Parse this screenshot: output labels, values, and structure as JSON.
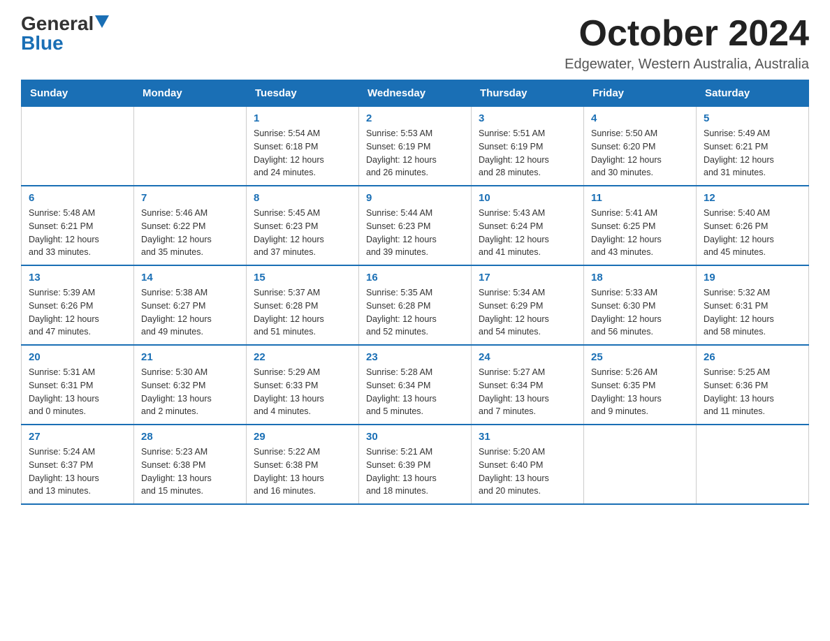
{
  "header": {
    "logo_general": "General",
    "logo_blue": "Blue",
    "month_title": "October 2024",
    "location": "Edgewater, Western Australia, Australia"
  },
  "weekdays": [
    "Sunday",
    "Monday",
    "Tuesday",
    "Wednesday",
    "Thursday",
    "Friday",
    "Saturday"
  ],
  "weeks": [
    [
      {
        "day": "",
        "info": ""
      },
      {
        "day": "",
        "info": ""
      },
      {
        "day": "1",
        "info": "Sunrise: 5:54 AM\nSunset: 6:18 PM\nDaylight: 12 hours\nand 24 minutes."
      },
      {
        "day": "2",
        "info": "Sunrise: 5:53 AM\nSunset: 6:19 PM\nDaylight: 12 hours\nand 26 minutes."
      },
      {
        "day": "3",
        "info": "Sunrise: 5:51 AM\nSunset: 6:19 PM\nDaylight: 12 hours\nand 28 minutes."
      },
      {
        "day": "4",
        "info": "Sunrise: 5:50 AM\nSunset: 6:20 PM\nDaylight: 12 hours\nand 30 minutes."
      },
      {
        "day": "5",
        "info": "Sunrise: 5:49 AM\nSunset: 6:21 PM\nDaylight: 12 hours\nand 31 minutes."
      }
    ],
    [
      {
        "day": "6",
        "info": "Sunrise: 5:48 AM\nSunset: 6:21 PM\nDaylight: 12 hours\nand 33 minutes."
      },
      {
        "day": "7",
        "info": "Sunrise: 5:46 AM\nSunset: 6:22 PM\nDaylight: 12 hours\nand 35 minutes."
      },
      {
        "day": "8",
        "info": "Sunrise: 5:45 AM\nSunset: 6:23 PM\nDaylight: 12 hours\nand 37 minutes."
      },
      {
        "day": "9",
        "info": "Sunrise: 5:44 AM\nSunset: 6:23 PM\nDaylight: 12 hours\nand 39 minutes."
      },
      {
        "day": "10",
        "info": "Sunrise: 5:43 AM\nSunset: 6:24 PM\nDaylight: 12 hours\nand 41 minutes."
      },
      {
        "day": "11",
        "info": "Sunrise: 5:41 AM\nSunset: 6:25 PM\nDaylight: 12 hours\nand 43 minutes."
      },
      {
        "day": "12",
        "info": "Sunrise: 5:40 AM\nSunset: 6:26 PM\nDaylight: 12 hours\nand 45 minutes."
      }
    ],
    [
      {
        "day": "13",
        "info": "Sunrise: 5:39 AM\nSunset: 6:26 PM\nDaylight: 12 hours\nand 47 minutes."
      },
      {
        "day": "14",
        "info": "Sunrise: 5:38 AM\nSunset: 6:27 PM\nDaylight: 12 hours\nand 49 minutes."
      },
      {
        "day": "15",
        "info": "Sunrise: 5:37 AM\nSunset: 6:28 PM\nDaylight: 12 hours\nand 51 minutes."
      },
      {
        "day": "16",
        "info": "Sunrise: 5:35 AM\nSunset: 6:28 PM\nDaylight: 12 hours\nand 52 minutes."
      },
      {
        "day": "17",
        "info": "Sunrise: 5:34 AM\nSunset: 6:29 PM\nDaylight: 12 hours\nand 54 minutes."
      },
      {
        "day": "18",
        "info": "Sunrise: 5:33 AM\nSunset: 6:30 PM\nDaylight: 12 hours\nand 56 minutes."
      },
      {
        "day": "19",
        "info": "Sunrise: 5:32 AM\nSunset: 6:31 PM\nDaylight: 12 hours\nand 58 minutes."
      }
    ],
    [
      {
        "day": "20",
        "info": "Sunrise: 5:31 AM\nSunset: 6:31 PM\nDaylight: 13 hours\nand 0 minutes."
      },
      {
        "day": "21",
        "info": "Sunrise: 5:30 AM\nSunset: 6:32 PM\nDaylight: 13 hours\nand 2 minutes."
      },
      {
        "day": "22",
        "info": "Sunrise: 5:29 AM\nSunset: 6:33 PM\nDaylight: 13 hours\nand 4 minutes."
      },
      {
        "day": "23",
        "info": "Sunrise: 5:28 AM\nSunset: 6:34 PM\nDaylight: 13 hours\nand 5 minutes."
      },
      {
        "day": "24",
        "info": "Sunrise: 5:27 AM\nSunset: 6:34 PM\nDaylight: 13 hours\nand 7 minutes."
      },
      {
        "day": "25",
        "info": "Sunrise: 5:26 AM\nSunset: 6:35 PM\nDaylight: 13 hours\nand 9 minutes."
      },
      {
        "day": "26",
        "info": "Sunrise: 5:25 AM\nSunset: 6:36 PM\nDaylight: 13 hours\nand 11 minutes."
      }
    ],
    [
      {
        "day": "27",
        "info": "Sunrise: 5:24 AM\nSunset: 6:37 PM\nDaylight: 13 hours\nand 13 minutes."
      },
      {
        "day": "28",
        "info": "Sunrise: 5:23 AM\nSunset: 6:38 PM\nDaylight: 13 hours\nand 15 minutes."
      },
      {
        "day": "29",
        "info": "Sunrise: 5:22 AM\nSunset: 6:38 PM\nDaylight: 13 hours\nand 16 minutes."
      },
      {
        "day": "30",
        "info": "Sunrise: 5:21 AM\nSunset: 6:39 PM\nDaylight: 13 hours\nand 18 minutes."
      },
      {
        "day": "31",
        "info": "Sunrise: 5:20 AM\nSunset: 6:40 PM\nDaylight: 13 hours\nand 20 minutes."
      },
      {
        "day": "",
        "info": ""
      },
      {
        "day": "",
        "info": ""
      }
    ]
  ]
}
